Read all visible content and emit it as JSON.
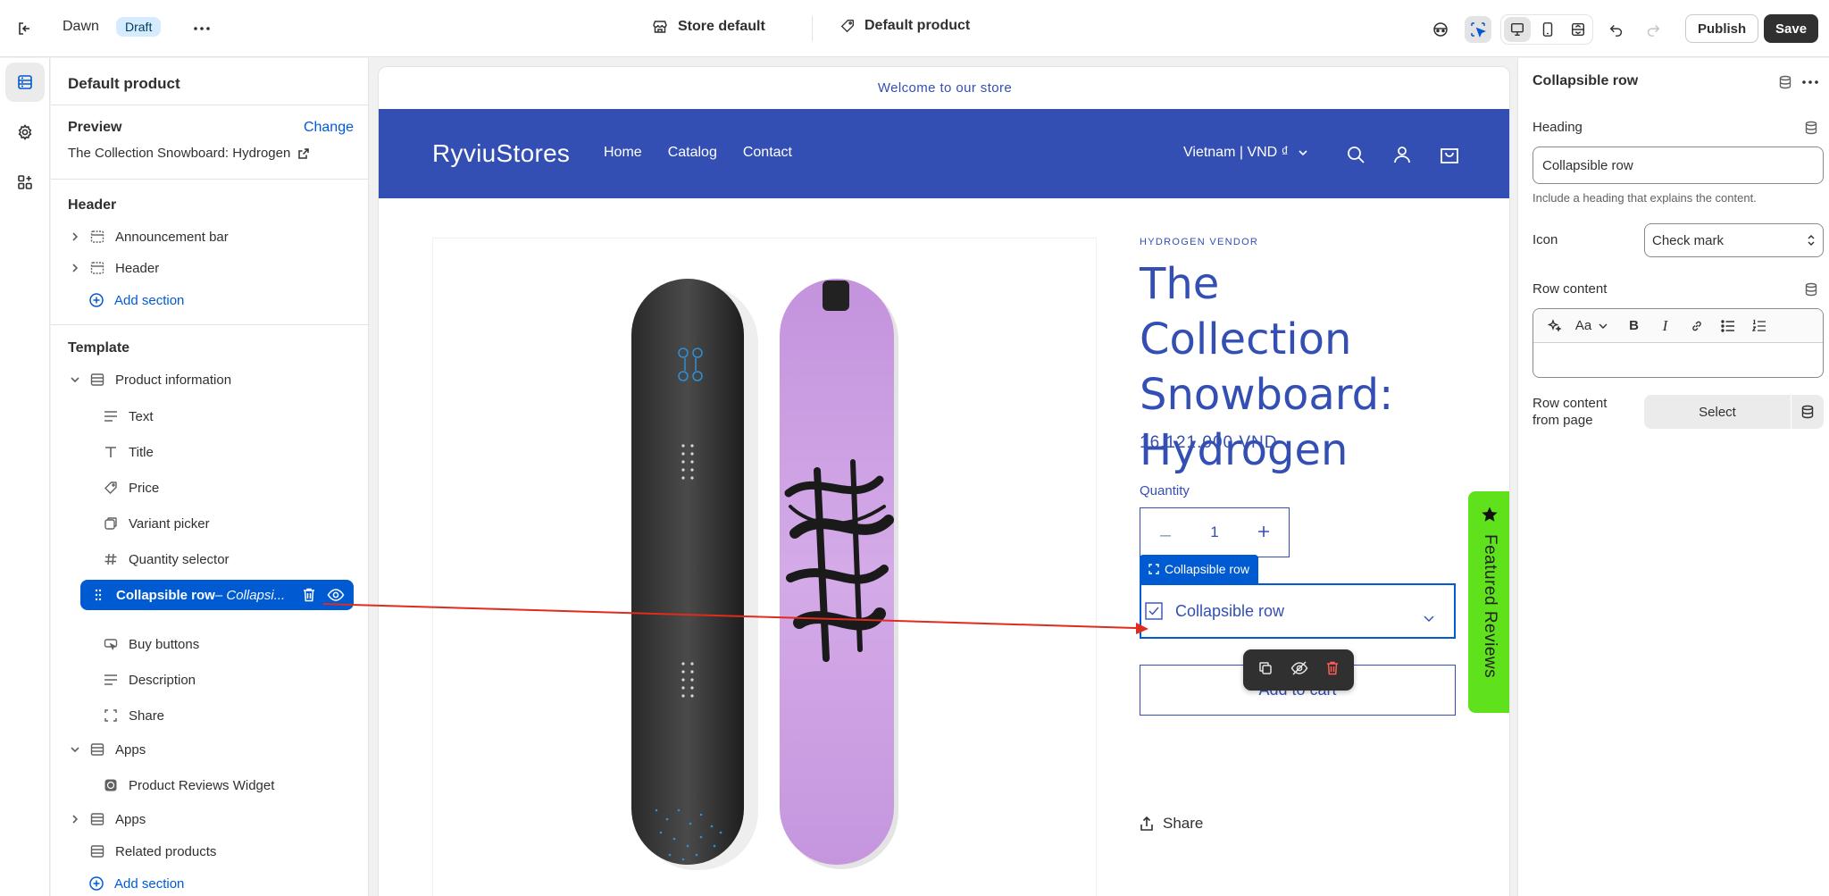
{
  "topbar": {
    "theme_name": "Dawn",
    "status_badge": "Draft",
    "store_selector": "Store default",
    "template_selector": "Default product",
    "publish_label": "Publish",
    "save_label": "Save"
  },
  "left_panel": {
    "title": "Default product",
    "preview_label": "Preview",
    "change_label": "Change",
    "preview_value": "The Collection Snowboard: Hydrogen",
    "header_group": "Header",
    "header_items": [
      "Announcement bar",
      "Header"
    ],
    "add_section": "Add section",
    "template_group": "Template",
    "product_information": "Product information",
    "blocks": [
      "Text",
      "Title",
      "Price",
      "Variant picker",
      "Quantity selector"
    ],
    "selected_block_name": "Collapsible row",
    "selected_block_sub": " – Collapsi...",
    "blocks_after": [
      "Buy buttons",
      "Description",
      "Share"
    ],
    "apps_1": "Apps",
    "product_reviews_widget": "Product Reviews Widget",
    "apps_2": "Apps",
    "related_products": "Related products",
    "add_section_2": "Add section"
  },
  "preview": {
    "announcement": "Welcome to our store",
    "logo": "RyviuStores",
    "nav": [
      "Home",
      "Catalog",
      "Contact"
    ],
    "locale": "Vietnam | VND ₫",
    "vendor": "HYDROGEN VENDOR",
    "product_title": "The Collection Snowboard: Hydrogen",
    "price": "16.121.000 VND",
    "quantity_label": "Quantity",
    "quantity_value": "1",
    "collapsible_tag": "Collapsible row",
    "collapsible_row": "Collapsible row",
    "add_to_cart": "Add to cart",
    "share": "Share",
    "featured_reviews": "Featured Reviews"
  },
  "right_panel": {
    "title": "Collapsible row",
    "heading_label": "Heading",
    "heading_value": "Collapsible row",
    "heading_help": "Include a heading that explains the content.",
    "icon_label": "Icon",
    "icon_value": "Check mark",
    "row_content_label": "Row content",
    "row_content_from_page_label_1": "Row content",
    "row_content_from_page_label_2": "from page",
    "select_label": "Select"
  },
  "colors": {
    "brand_blue": "#334fb4",
    "accent_blue": "#005bd3",
    "reviews_green": "#5fe21c",
    "snowboard_purple": "#c79be0",
    "arrow_red": "#e02b1d"
  }
}
